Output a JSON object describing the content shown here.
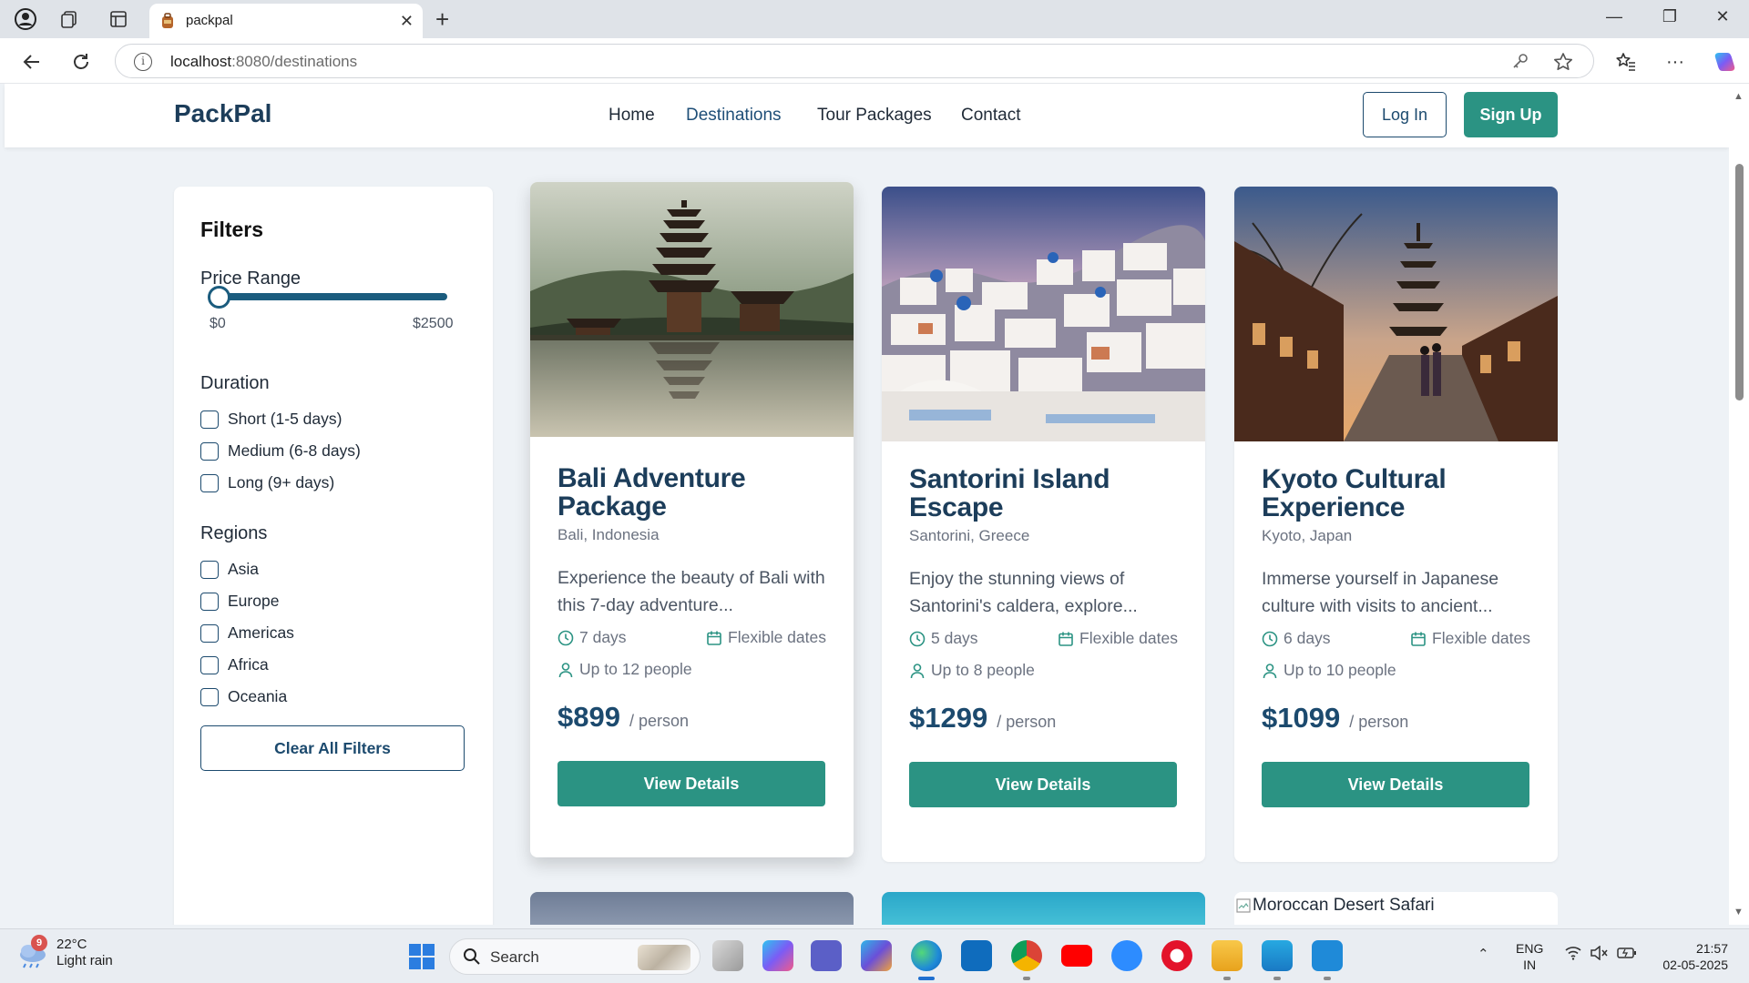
{
  "browser": {
    "tab_title": "packpal",
    "url_host": "localhost",
    "url_path": ":8080/destinations"
  },
  "site": {
    "brand": "PackPal",
    "nav": [
      {
        "label": "Home",
        "active": false
      },
      {
        "label": "Destinations",
        "active": true
      },
      {
        "label": "Tour Packages",
        "active": false
      },
      {
        "label": "Contact",
        "active": false
      }
    ],
    "login_label": "Log In",
    "signup_label": "Sign Up"
  },
  "filters": {
    "title": "Filters",
    "price_range": {
      "label": "Price Range",
      "min_label": "$0",
      "max_label": "$2500",
      "value": 0
    },
    "duration": {
      "label": "Duration",
      "options": [
        "Short (1-5 days)",
        "Medium (6-8 days)",
        "Long (9+ days)"
      ]
    },
    "regions": {
      "label": "Regions",
      "options": [
        "Asia",
        "Europe",
        "Americas",
        "Africa",
        "Oceania"
      ]
    },
    "clear_label": "Clear All Filters"
  },
  "cards": [
    {
      "title": "Bali Adventure Package",
      "location": "Bali, Indonesia",
      "description": "Experience the beauty of Bali with this 7-day adventure...",
      "duration": "7 days",
      "dates": "Flexible dates",
      "group": "Up to 12 people",
      "price": "$899",
      "per": "/ person",
      "cta": "View Details"
    },
    {
      "title": "Santorini Island Escape",
      "location": "Santorini, Greece",
      "description": "Enjoy the stunning views of Santorini's caldera, explore...",
      "duration": "5 days",
      "dates": "Flexible dates",
      "group": "Up to 8 people",
      "price": "$1299",
      "per": "/ person",
      "cta": "View Details"
    },
    {
      "title": "Kyoto Cultural Experience",
      "location": "Kyoto, Japan",
      "description": "Immerse yourself in Japanese culture with visits to ancient...",
      "duration": "6 days",
      "dates": "Flexible dates",
      "group": "Up to 10 people",
      "price": "$1099",
      "per": "/ person",
      "cta": "View Details"
    }
  ],
  "next_row": {
    "broken_image_alt": "Moroccan Desert Safari"
  },
  "taskbar": {
    "weather_temp": "22°C",
    "weather_desc": "Light rain",
    "weather_badge": "9",
    "search_label": "Search",
    "lang_top": "ENG",
    "lang_bottom": "IN",
    "time": "21:57",
    "date": "02-05-2025"
  },
  "colors": {
    "brand_dark": "#1c3d5a",
    "accent_teal": "#2b9383",
    "page_bg": "#eef2f6"
  }
}
